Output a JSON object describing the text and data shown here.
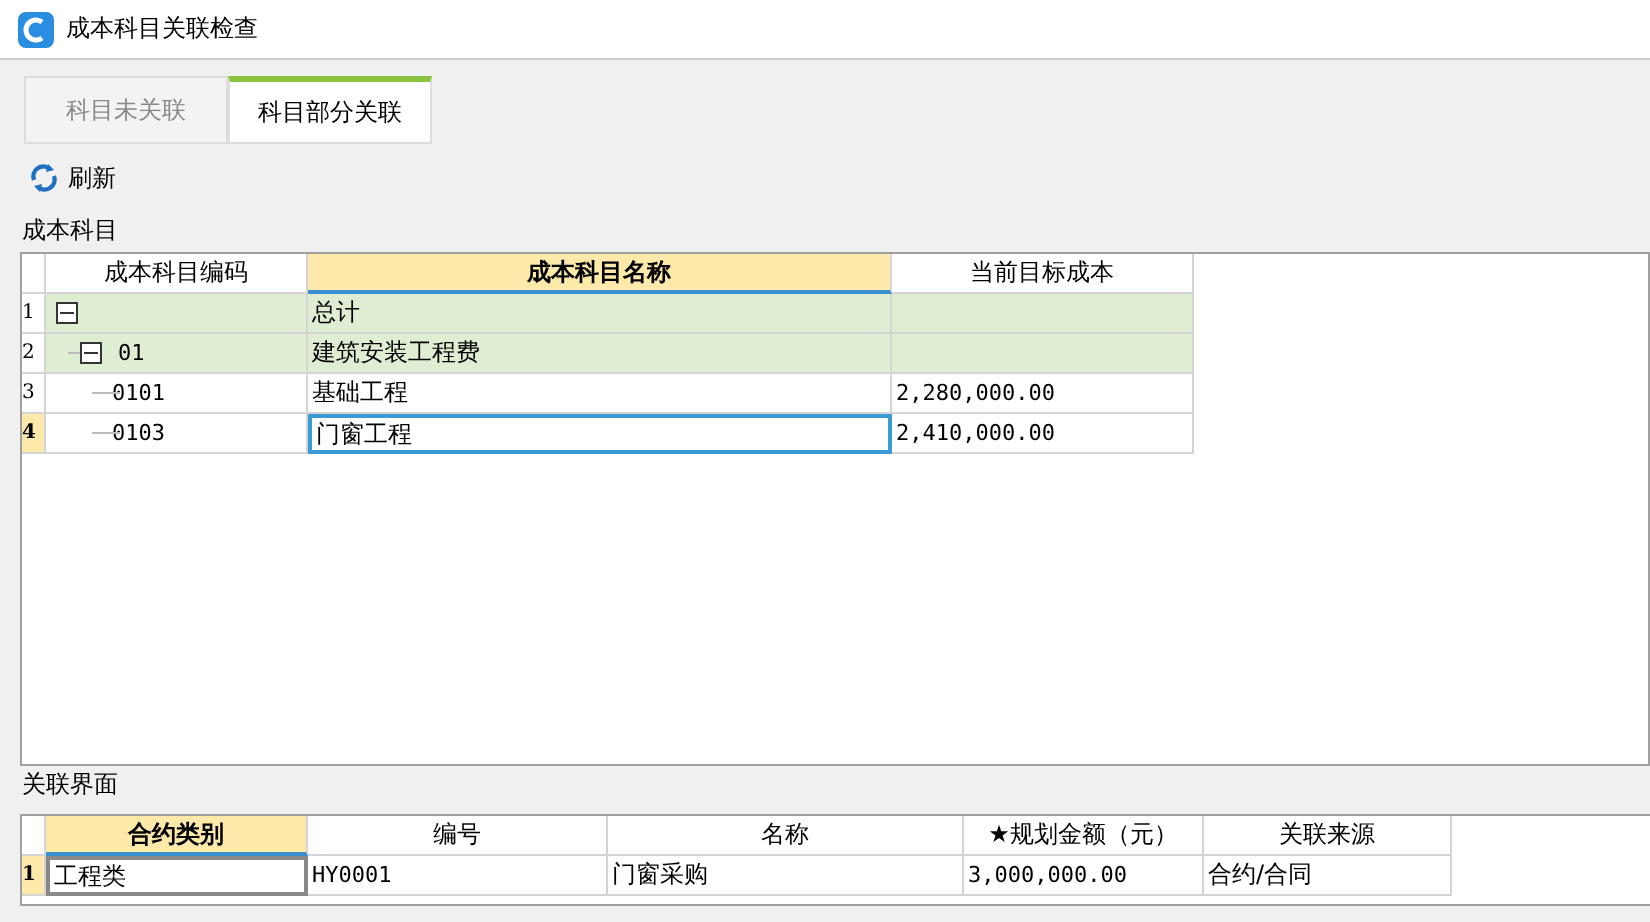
{
  "window": {
    "title": "成本科目关联检查"
  },
  "tabs": [
    {
      "label": "科目未关联",
      "selected": false
    },
    {
      "label": "科目部分关联",
      "selected": true
    }
  ],
  "toolbar": {
    "refresh": "刷新"
  },
  "cost_section": {
    "label": "成本科目",
    "columns": [
      {
        "label": "成本科目编码",
        "selected": false
      },
      {
        "label": "成本科目名称",
        "selected": true
      },
      {
        "label": "当前目标成本",
        "selected": false
      }
    ],
    "rows": [
      {
        "num": "1",
        "name": "总计",
        "selected": false,
        "expanded": true,
        "children": [
          {
            "num": "2",
            "code": "01",
            "name": "建筑安装工程费",
            "selected": false,
            "expanded": true,
            "children": [
              {
                "num": "3",
                "code": "0101",
                "name": "基础工程",
                "cost": "2,280,000.00",
                "selected": false
              },
              {
                "num": "4",
                "code": "0103",
                "name": "门窗工程",
                "cost": "2,410,000.00",
                "selected": true
              }
            ]
          }
        ]
      }
    ]
  },
  "link_section": {
    "label": "关联界面",
    "columns": [
      {
        "label": "合约类别",
        "selected": true
      },
      {
        "label": "编号",
        "selected": false
      },
      {
        "label": "名称",
        "selected": false
      },
      {
        "label": "★规划金额（元）",
        "selected": false
      },
      {
        "label": "关联来源",
        "selected": false
      }
    ],
    "rows": [
      {
        "num": "1",
        "cells": [
          "工程类",
          "HY0001",
          "门窗采购",
          "3,000,000.00",
          "合约/合同"
        ],
        "selected": true
      }
    ]
  }
}
